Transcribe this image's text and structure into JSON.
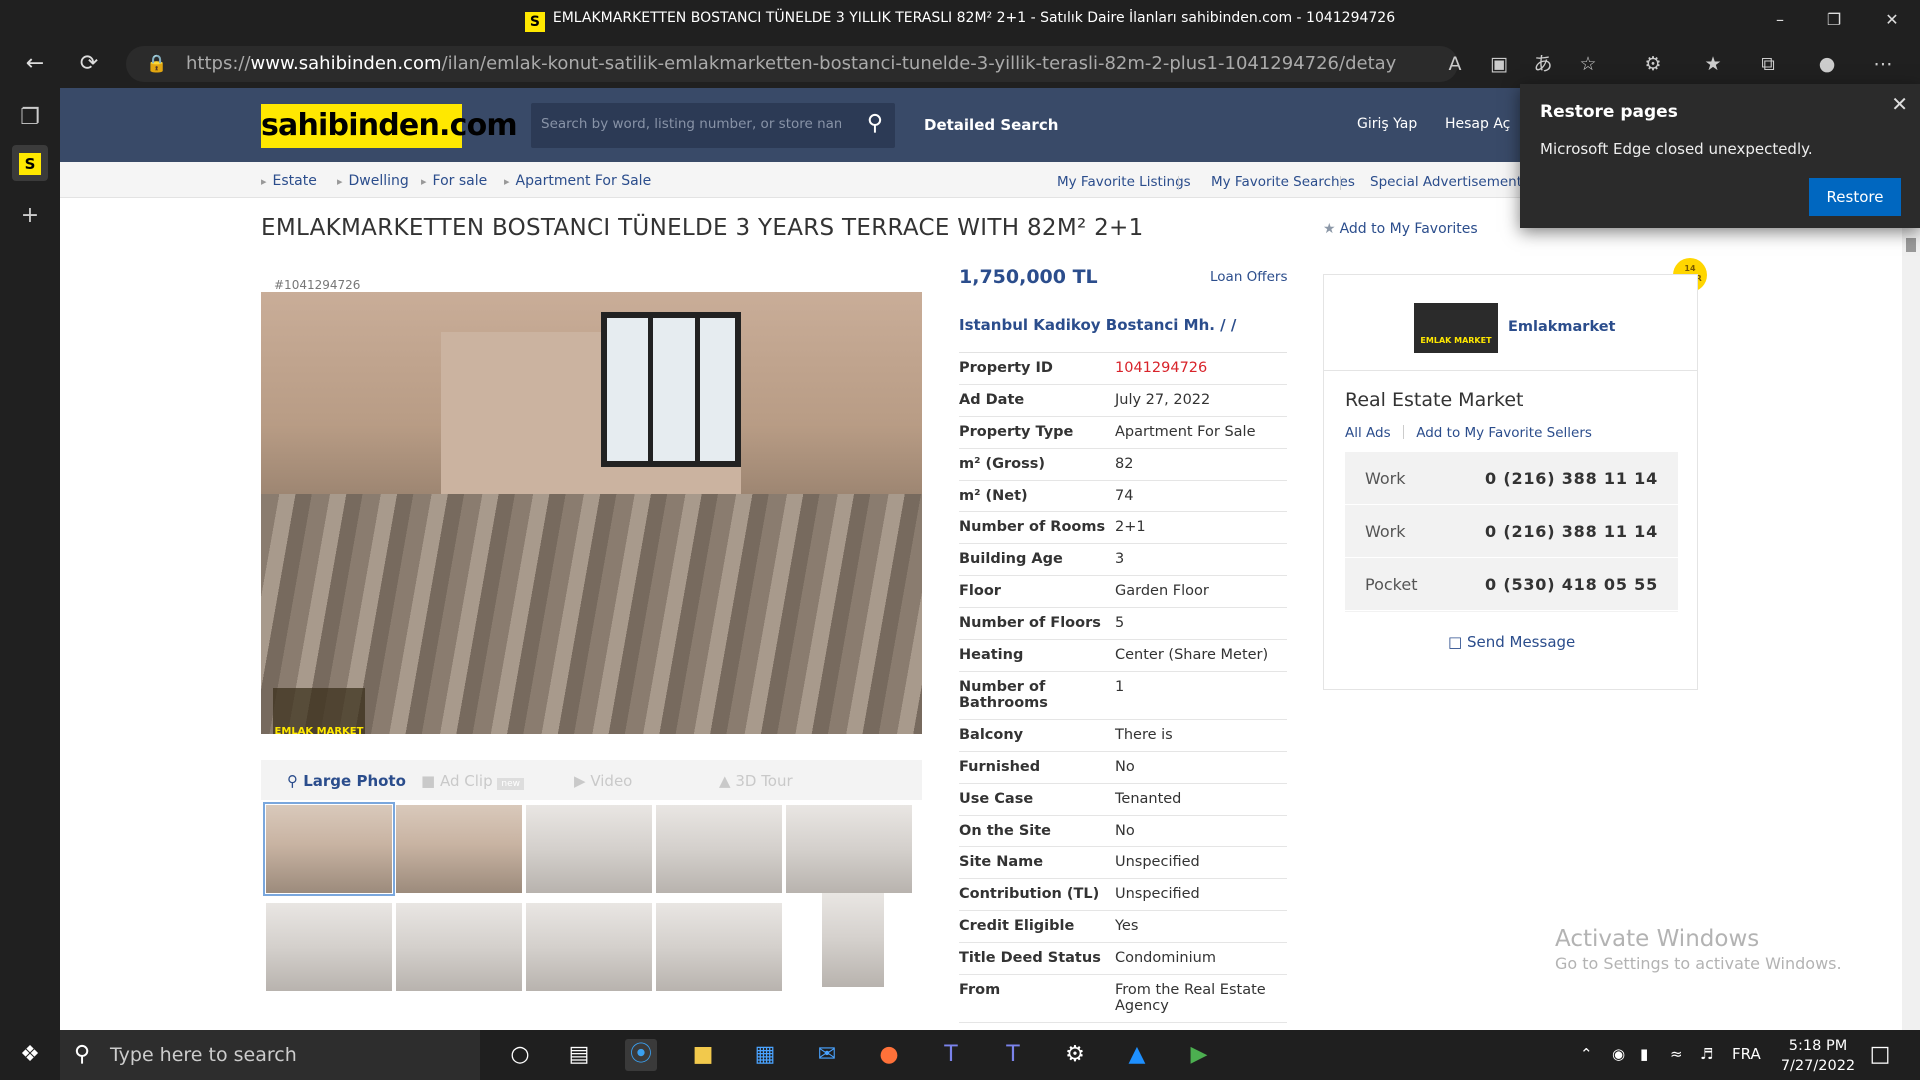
{
  "browser": {
    "tab_title": "EMLAKMARKETTEN BOSTANCI TÜNELDE 3 YILLIK TERASLI 82M² 2+1 - Satılık Daire İlanları sahibinden.com - 1041294726",
    "favicon": "S",
    "url_prefix": "https://",
    "url_host": "www.sahibinden.com",
    "url_path": "/ilan/emlak-konut-satilik-emlakmarketten-bostanci-tunelde-3-yillik-terasli-82m-2-plus1-1041294726/detay"
  },
  "restore_popup": {
    "title": "Restore pages",
    "message": "Microsoft Edge closed unexpectedly.",
    "button": "Restore"
  },
  "header": {
    "logo": "sahibinden.com",
    "search_placeholder": "Search by word, listing number, or store name",
    "detailed_search": "Detailed Search",
    "login": "Giriş Yap",
    "register": "Hesap Aç"
  },
  "breadcrumb": [
    "Estate",
    "Dwelling",
    "For sale",
    "Apartment For Sale"
  ],
  "top_links": {
    "fav_listings": "My Favorite Listings",
    "fav_searches": "My Favorite Searches",
    "special_ads": "Special Advertisements f"
  },
  "listing": {
    "title": "EMLAKMARKETTEN BOSTANCI TÜNELDE 3 YEARS TERRACE WITH 82M² 2+1",
    "add_favorites": "Add to My Favorites",
    "id_label": "#1041294726",
    "watermark": "EMLAK MARKET",
    "price": "1,750,000 TL",
    "loan_offers": "Loan Offers",
    "location": "Istanbul Kadikoy Bostanci Mh. /  /",
    "media_tabs": {
      "large_photo": "Large Photo",
      "ad_clip": "Ad Clip",
      "ad_clip_badge": "new",
      "video": "Video",
      "tour": "3D Tour"
    },
    "details": [
      {
        "k": "Property ID",
        "v": "1041294726"
      },
      {
        "k": "Ad Date",
        "v": "July 27, 2022"
      },
      {
        "k": "Property Type",
        "v": "Apartment For Sale"
      },
      {
        "k": "m² (Gross)",
        "v": "82"
      },
      {
        "k": "m² (Net)",
        "v": "74"
      },
      {
        "k": "Number of Rooms",
        "v": "2+1"
      },
      {
        "k": "Building Age",
        "v": "3"
      },
      {
        "k": "Floor",
        "v": "Garden Floor"
      },
      {
        "k": "Number of Floors",
        "v": "5"
      },
      {
        "k": "Heating",
        "v": "Center (Share Meter)"
      },
      {
        "k": "Number of Bathrooms",
        "v": "1"
      },
      {
        "k": "Balcony",
        "v": "There is"
      },
      {
        "k": "Furnished",
        "v": "No"
      },
      {
        "k": "Use Case",
        "v": "Tenanted"
      },
      {
        "k": "On the Site",
        "v": "No"
      },
      {
        "k": "Site Name",
        "v": "Unspecified"
      },
      {
        "k": "Contribution (TL)",
        "v": "Unspecified"
      },
      {
        "k": "Credit Eligible",
        "v": "Yes"
      },
      {
        "k": "Title Deed Status",
        "v": "Condominium"
      },
      {
        "k": "From",
        "v": "From the Real Estate Agency"
      }
    ]
  },
  "seller": {
    "logo_text": "EMLAK MARKET",
    "name": "Emlakmarket",
    "badge_number": "14",
    "badge_word": "YEAR",
    "store_title": "Real Estate Market",
    "all_ads": "All Ads",
    "add_fav_seller": "Add to My Favorite Sellers",
    "phones": [
      {
        "label": "Work",
        "number": "0 (216) 388 11 14"
      },
      {
        "label": "Work",
        "number": "0 (216) 388 11 14"
      },
      {
        "label": "Pocket",
        "number": "0 (530) 418 05 55"
      }
    ],
    "send_message": "Send Message"
  },
  "activate_windows": {
    "line1": "Activate Windows",
    "line2": "Go to Settings to activate Windows."
  },
  "taskbar": {
    "search_placeholder": "Type here to search",
    "language": "FRA",
    "time": "5:18 PM",
    "date": "7/27/2022"
  }
}
